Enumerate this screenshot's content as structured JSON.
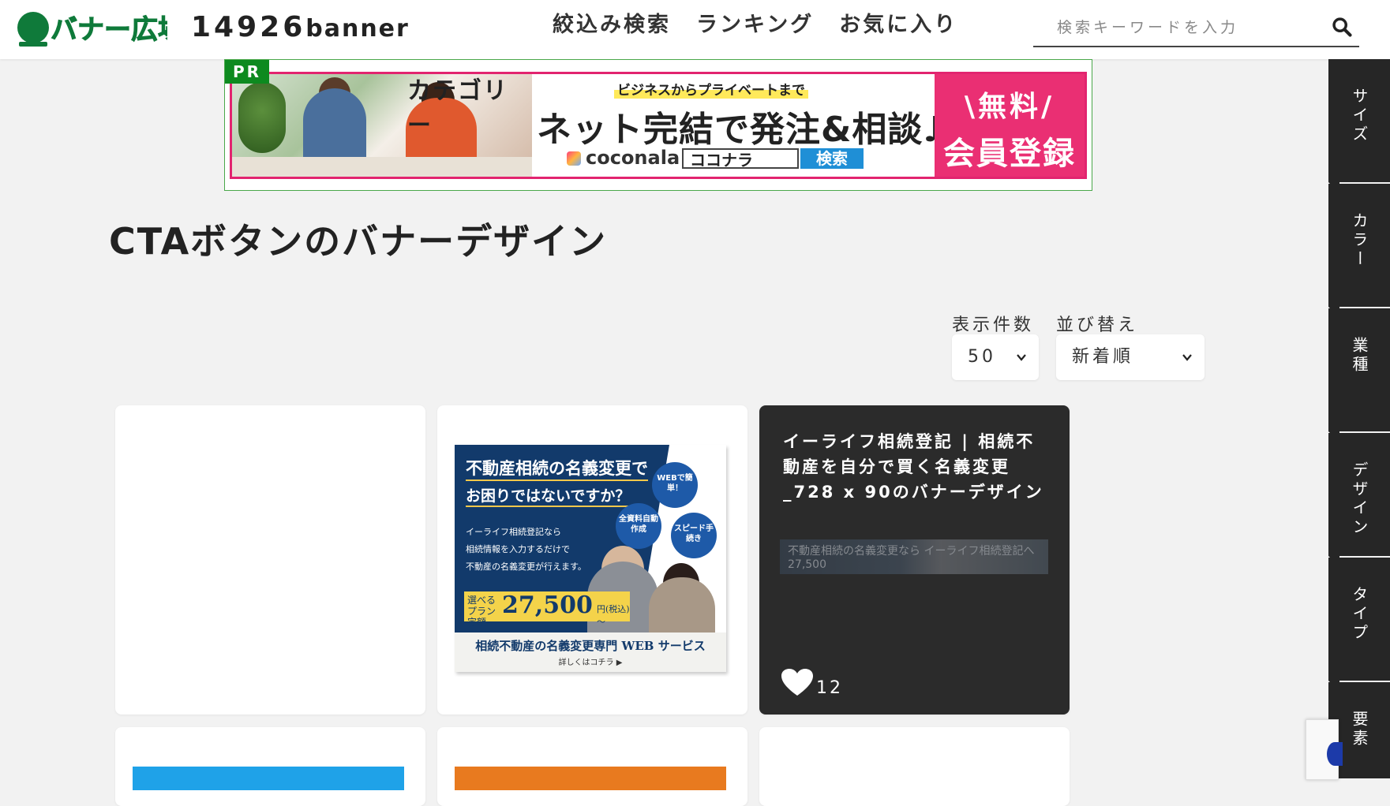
{
  "header": {
    "logo_text": "バナー広場",
    "site_name_num": "14926",
    "site_name_word": "banner",
    "nav": [
      "絞込み検索",
      "ランキング",
      "お気に入り"
    ],
    "search_placeholder": "検索キーワードを入力"
  },
  "ad": {
    "pr_label": "PR",
    "category_text": "カテゴリー",
    "sub": "ビジネスからプライベートまで",
    "main": "ネット完結で発注&相談♪",
    "brand": "coconala",
    "search_box": "ココナラ",
    "search_button": "検索",
    "free": "\\無料/",
    "register": "会員登録"
  },
  "page": {
    "title": "CTAボタンのバナーデザイン"
  },
  "controls": {
    "count_label": "表示件数",
    "count_value": "50",
    "sort_label": "並び替え",
    "sort_value": "新着順"
  },
  "cards": {
    "card2": {
      "line1": "不動産相続の名義変更で",
      "line2": "お困りではないですか？",
      "body1": "イーライフ相続登記なら",
      "body2": "相続情報を入力するだけで",
      "body3": "不動産の名義変更が行えます。",
      "badge1": "WEBで簡単！",
      "badge2": "全資料自動作成",
      "badge3": "スピード手続き",
      "price_label": "選べるプラン定額",
      "price": "27,500",
      "price_unit": "円(税込)～",
      "footer": "相続不動産の名義変更専門 WEB サービス",
      "footer_link": "詳しくはコチラ ▶"
    },
    "card3": {
      "title": "イーライフ相続登記 | 相続不動産を自分で買く名義変更_728 x 90のバナーデザイン",
      "thumb_text": "不動産相続の名義変更なら イーライフ相続登記へ　27,500",
      "likes": "12"
    }
  },
  "side_tabs": [
    "サイズ",
    "カラー",
    "業種",
    "デザイン",
    "タイプ",
    "要素"
  ],
  "colors": {
    "dark_card": "#2b2b2b",
    "pr_green": "#0d8a1f",
    "ad_pink": "#ea2f73",
    "side_tab": "#262626"
  }
}
